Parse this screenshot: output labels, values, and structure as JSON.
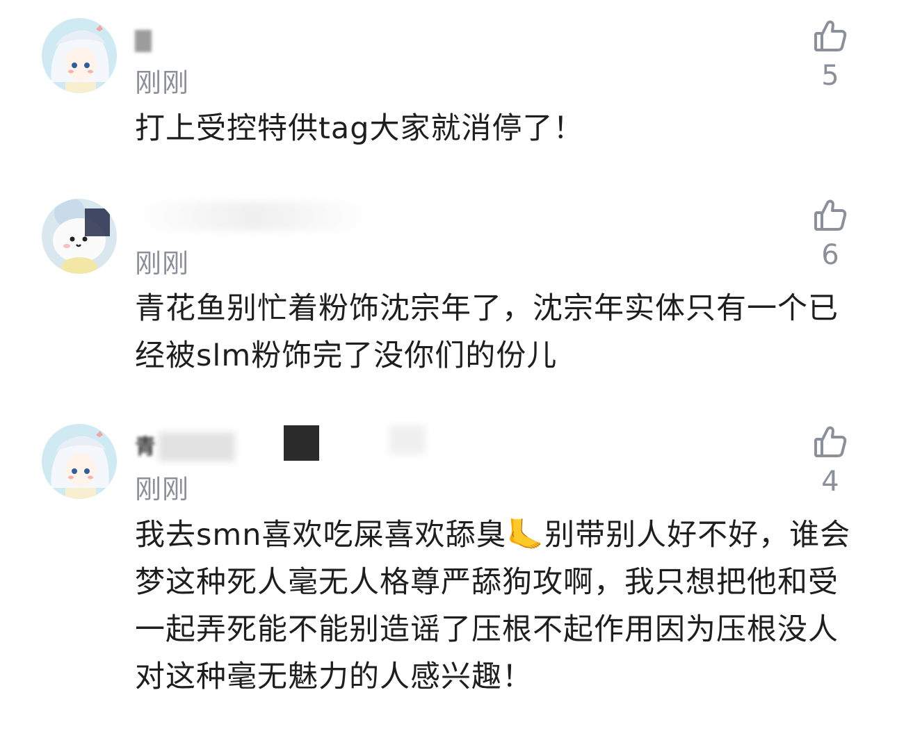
{
  "comments": [
    {
      "time": "刚刚",
      "likes": "5",
      "text": "打上受控特供tag大家就消停了！",
      "icon": "thumbs-up-icon"
    },
    {
      "time": "刚刚",
      "likes": "6",
      "text": "青花鱼别忙着粉饰沈宗年了，沈宗年实体只有一个已经被slm粉饰完了没你们的份儿",
      "icon": "thumbs-up-icon"
    },
    {
      "time": "刚刚",
      "likes": "4",
      "username_prefix": "青",
      "text": "我去smn喜欢吃屎喜欢舔臭🦶别带别人好不好，谁会梦这种死人毫无人格尊严舔狗攻啊，我只想把他和受一起弄死能不能别造谣了压根不起作用因为压根没人对这种毫无魅力的人感兴趣！",
      "icon": "thumbs-up-icon"
    }
  ],
  "colors": {
    "meta_gray": "#8a8f99",
    "text": "#1e1e1e",
    "background": "#ffffff"
  }
}
